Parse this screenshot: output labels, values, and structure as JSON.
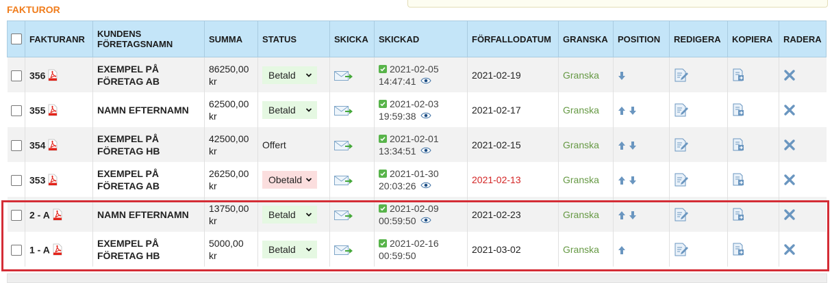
{
  "section_title": "FAKTUROR",
  "columns": {
    "number": "FAKTURANR",
    "company": "KUNDENS FÖRETAGSNAMN",
    "sum": "SUMMA",
    "status": "STATUS",
    "send": "SKICKA",
    "sent": "SKICKAD",
    "due": "FÖRFALLODATUM",
    "review": "GRANSKA",
    "position": "POSITION",
    "edit": "REDIGERA",
    "copy": "KOPIERA",
    "delete": "RADERA"
  },
  "invoices": [
    {
      "number": "356",
      "company": "EXEMPEL PÅ FÖRETAG AB",
      "sum": "86250,00 kr",
      "status": "Betald",
      "status_kind": "select-paid",
      "sent_date": "2021-02-05",
      "sent_time": "14:47:41",
      "viewed": true,
      "due": "2021-02-19",
      "overdue": false,
      "review": "Granska",
      "up": false,
      "down": true
    },
    {
      "number": "355",
      "company": "NAMN EFTERNAMN",
      "sum": "62500,00 kr",
      "status": "Betald",
      "status_kind": "select-paid",
      "sent_date": "2021-02-03",
      "sent_time": "19:59:38",
      "viewed": true,
      "due": "2021-02-17",
      "overdue": false,
      "review": "Granska",
      "up": true,
      "down": true
    },
    {
      "number": "354",
      "company": "EXEMPEL PÅ FÖRETAG HB",
      "sum": "42500,00 kr",
      "status": "Offert",
      "status_kind": "text",
      "sent_date": "2021-02-01",
      "sent_time": "13:34:51",
      "viewed": true,
      "due": "2021-02-15",
      "overdue": false,
      "review": "Granska",
      "up": true,
      "down": true
    },
    {
      "number": "353",
      "company": "EXEMPEL PÅ FÖRETAG AB",
      "sum": "26250,00 kr",
      "status": "Obetald",
      "status_kind": "select-unpaid",
      "sent_date": "2021-01-30",
      "sent_time": "20:03:26",
      "viewed": true,
      "due": "2021-02-13",
      "overdue": true,
      "review": "Granska",
      "up": true,
      "down": true
    },
    {
      "number": "2 - A",
      "company": "NAMN EFTERNAMN",
      "sum": "13750,00 kr",
      "status": "Betald",
      "status_kind": "select-paid",
      "sent_date": "2021-02-09",
      "sent_time": "00:59:50",
      "viewed": true,
      "due": "2021-02-23",
      "overdue": false,
      "review": "Granska",
      "up": true,
      "down": true
    },
    {
      "number": "1 - A",
      "company": "EXEMPEL PÅ FÖRETAG HB",
      "sum": "5000,00 kr",
      "status": "Betald",
      "status_kind": "select-paid",
      "sent_date": "2021-02-16",
      "sent_time": "00:59:50",
      "viewed": false,
      "due": "2021-03-02",
      "overdue": false,
      "review": "Granska",
      "up": true,
      "down": false
    }
  ],
  "colors": {
    "title_orange": "#f07c1b",
    "header_blue": "#c4e5f8",
    "review_green": "#669944",
    "overdue_red": "#d32424",
    "highlight_red": "#d42d36",
    "paid_bg": "#e5f8e2",
    "unpaid_bg": "#fbdede",
    "icon_blue": "#6a96c0"
  },
  "icons": {
    "pdf": "pdf-icon",
    "send": "send-mail-icon",
    "sent_check": "check-icon",
    "viewed": "eye-icon",
    "up": "arrow-up-icon",
    "down": "arrow-down-icon",
    "edit": "edit-icon",
    "copy": "copy-icon",
    "delete": "delete-x-icon",
    "dropdown": "chevron-down-icon"
  }
}
